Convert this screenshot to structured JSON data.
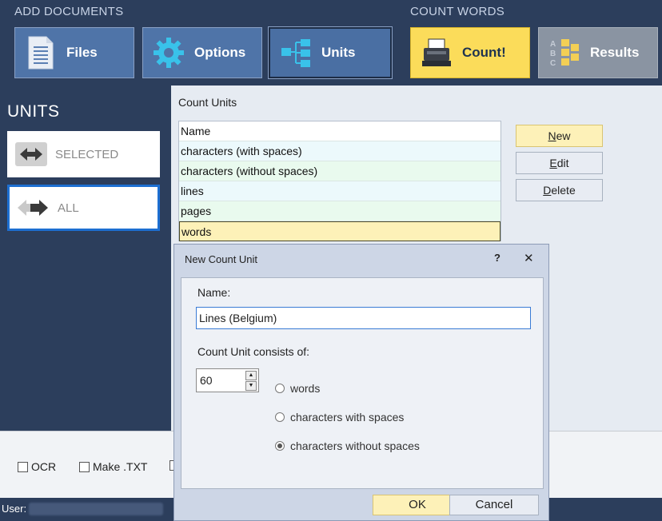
{
  "header": {
    "add_documents_label": "ADD DOCUMENTS",
    "count_words_label": "COUNT WORDS",
    "buttons": [
      {
        "label": "Files",
        "icon": "document-icon"
      },
      {
        "label": "Options",
        "icon": "gear-icon"
      },
      {
        "label": "Units",
        "icon": "hierarchy-icon"
      },
      {
        "label": "Count!",
        "icon": "cash-register-icon"
      },
      {
        "label": "Results",
        "icon": "abc-list-icon"
      }
    ]
  },
  "sidebar": {
    "title": "UNITS",
    "items": [
      {
        "label": "SELECTED",
        "icon": "double-arrow-icon"
      },
      {
        "label": "ALL",
        "icon": "double-arrow-icon"
      }
    ]
  },
  "count_units": {
    "title": "Count Units",
    "column_header": "Name",
    "rows": [
      "characters (with spaces)",
      "characters (without spaces)",
      "lines",
      "pages",
      "words"
    ],
    "buttons": [
      {
        "underline": "N",
        "rest": "ew"
      },
      {
        "underline": "E",
        "rest": "dit"
      },
      {
        "underline": "D",
        "rest": "elete"
      }
    ]
  },
  "options_bar": {
    "checkboxes": [
      "OCR",
      "Make .TXT"
    ]
  },
  "status": {
    "user_label": "User:"
  },
  "dialog": {
    "title": "New Count Unit",
    "help": "?",
    "close": "✕",
    "name_label": "Name:",
    "name_value": "Lines (Belgium)",
    "consists_label": "Count Unit consists of:",
    "quantity": "60",
    "options": [
      "words",
      "characters with spaces",
      "characters without spaces"
    ],
    "selected_option": "characters without spaces",
    "ok_label": "OK",
    "cancel_label": "Cancel"
  }
}
